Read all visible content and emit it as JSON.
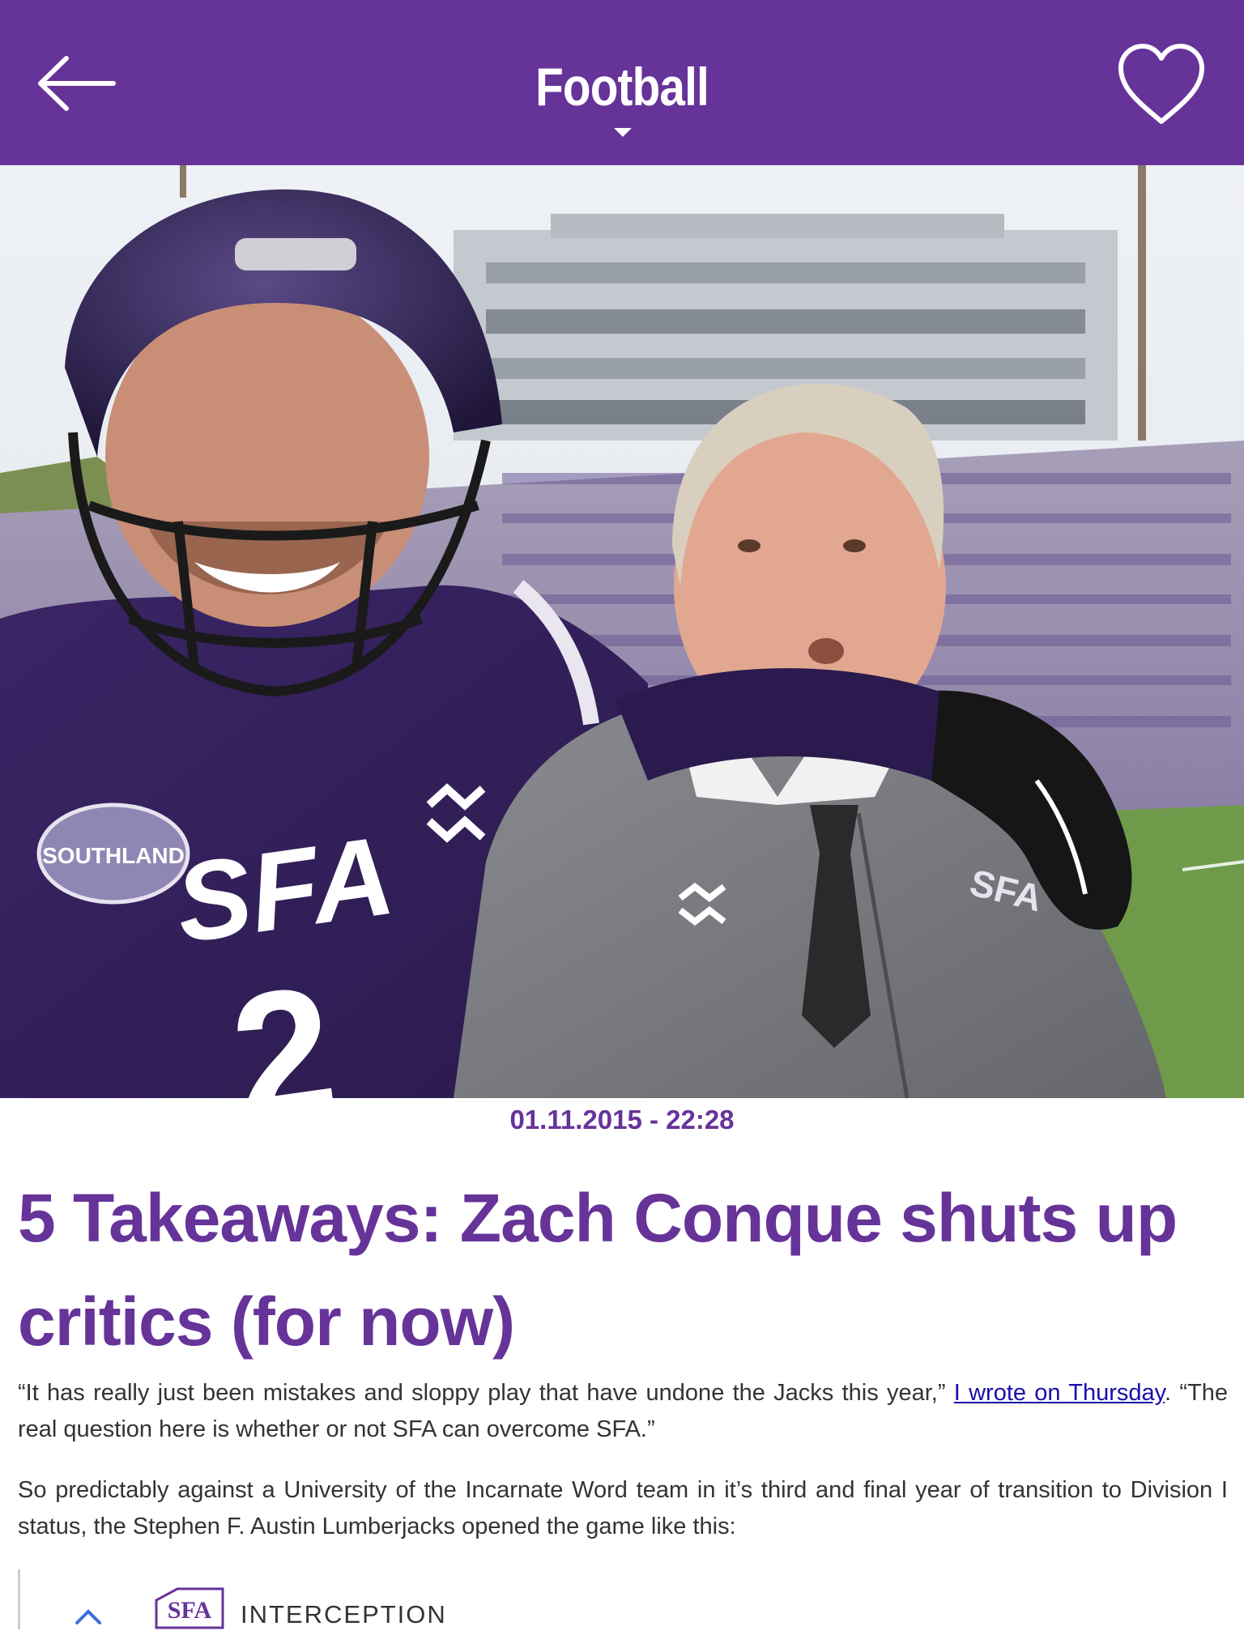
{
  "header": {
    "title": "Football",
    "back_icon": "arrow-left-icon",
    "favorite_icon": "heart-outline-icon",
    "dropdown_icon": "caret-down-icon",
    "background_color": "#663399"
  },
  "hero": {
    "jersey_text": "SFA",
    "jersey_number": "2",
    "patch_text": "SOUTHLAND",
    "coach_logo_text": "SFA"
  },
  "article": {
    "date": "01.11.2015 - 22:28",
    "title": "5 Takeaways: Zach Conque shuts up critics (for now)",
    "paragraphs": [
      {
        "before": "“It has really just been mistakes and sloppy play that have undone the Jacks this year,” ",
        "link": "I wrote on Thursday",
        "after": ". “The real question here is whether or not SFA can overcome SFA.”"
      },
      {
        "text": "So predictably against a University of the Incarnate Word team in it’s third and final year of transition to Division I status, the Stephen F. Austin Lumberjacks opened the game like this:"
      }
    ],
    "embed": {
      "title": "INTERCEPTION",
      "icon": "chevron-up-icon",
      "logo": "sfa-logo-icon"
    }
  },
  "colors": {
    "accent": "#663399",
    "body_text": "#333333",
    "link": "#1a0dab"
  }
}
